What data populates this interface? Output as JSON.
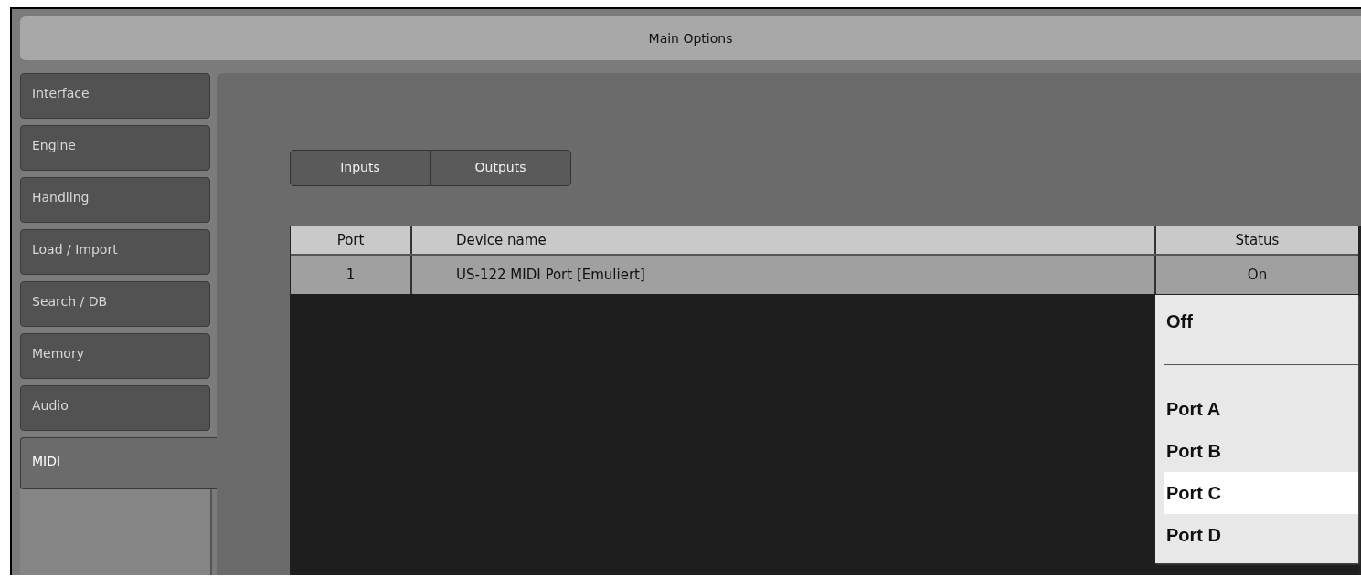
{
  "window": {
    "title": "Main Options"
  },
  "sidebar": {
    "items": [
      {
        "label": "Interface",
        "selected": false
      },
      {
        "label": "Engine",
        "selected": false
      },
      {
        "label": "Handling",
        "selected": false
      },
      {
        "label": "Load / Import",
        "selected": false
      },
      {
        "label": "Search / DB",
        "selected": false
      },
      {
        "label": "Memory",
        "selected": false
      },
      {
        "label": "Audio",
        "selected": false
      },
      {
        "label": "MIDI",
        "selected": true
      }
    ]
  },
  "tabs": [
    {
      "label": "Inputs",
      "selected": false
    },
    {
      "label": "Outputs",
      "selected": false
    }
  ],
  "table": {
    "columns": [
      "Port",
      "Device name",
      "Status"
    ],
    "rows": [
      {
        "port": "1",
        "device_name": "US-122 MIDI Port [Emuliert]",
        "status": "On"
      }
    ]
  },
  "status_menu": {
    "items": [
      {
        "kind": "option",
        "label": "Off",
        "selected": false
      },
      {
        "kind": "separator"
      },
      {
        "kind": "option",
        "label": "Port A",
        "selected": false
      },
      {
        "kind": "option",
        "label": "Port B",
        "selected": false
      },
      {
        "kind": "option",
        "label": "Port C",
        "selected": true
      },
      {
        "kind": "option",
        "label": "Port D",
        "selected": false
      }
    ]
  }
}
